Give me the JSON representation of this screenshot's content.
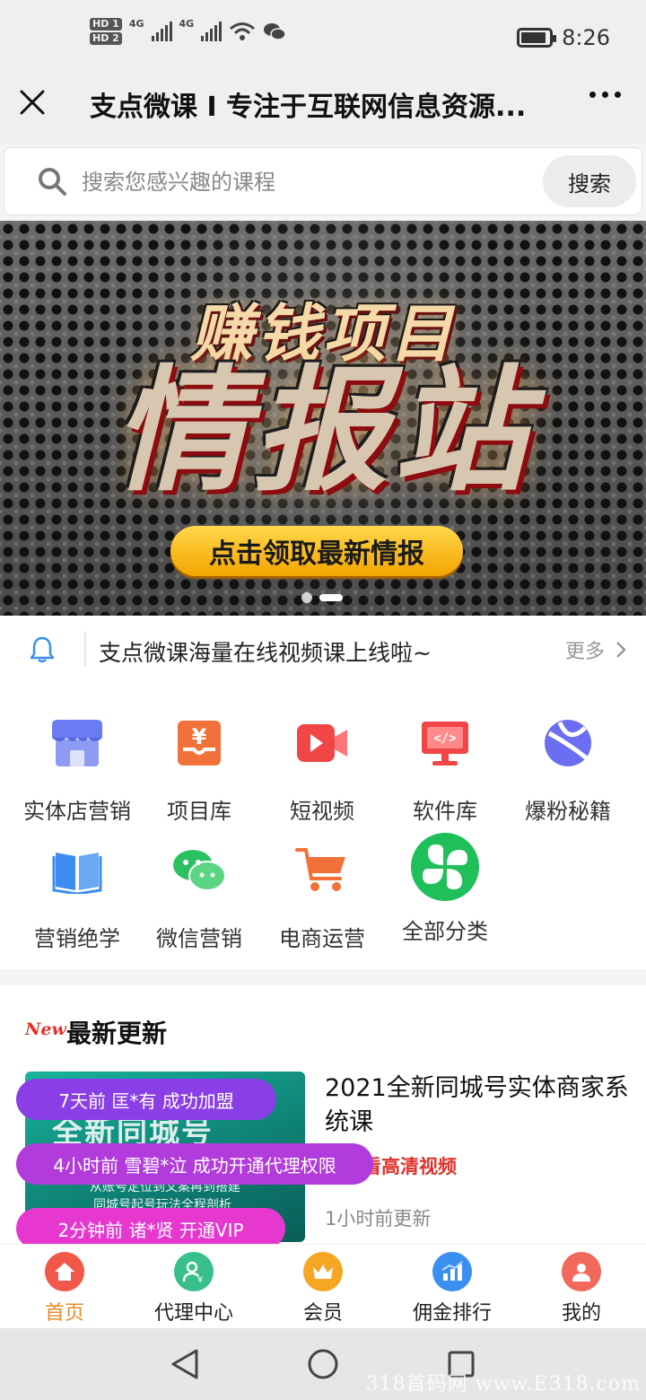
{
  "status_bar": {
    "hd1": "HD 1",
    "hd2": "HD 2",
    "net1": "4G",
    "net2": "4G",
    "time": "8:26",
    "battery_level": 0.9
  },
  "header": {
    "title": "支点微课 I 专注于互联网信息资源..."
  },
  "search": {
    "placeholder": "搜索您感兴趣的课程",
    "button_label": "搜索"
  },
  "banner": {
    "line1": "赚钱项目",
    "line2": "情报站",
    "cta": "点击领取最新情报",
    "slide_count": 2,
    "active_slide": 2
  },
  "notice": {
    "text": "支点微课海量在线视频课上线啦~",
    "more_label": "更多"
  },
  "categories": [
    {
      "label": "实体店营销",
      "icon": "storefront-icon",
      "color": "#6b7cf2"
    },
    {
      "label": "项目库",
      "icon": "yen-box-icon",
      "color": "#f2713a"
    },
    {
      "label": "短视频",
      "icon": "video-camera-icon",
      "color": "#f04646"
    },
    {
      "label": "软件库",
      "icon": "code-monitor-icon",
      "color": "#f04646"
    },
    {
      "label": "爆粉秘籍",
      "icon": "globe-icon",
      "color": "#6b6ef0"
    },
    {
      "label": "营销绝学",
      "icon": "book-icon",
      "color": "#3d8cf0"
    },
    {
      "label": "微信营销",
      "icon": "wechat-icon",
      "color": "#2cc160"
    },
    {
      "label": "电商运营",
      "icon": "shopping-cart-icon",
      "color": "#f2713a"
    },
    {
      "label": "全部分类",
      "icon": "clover-icon",
      "color": "#1fbf5a"
    }
  ],
  "latest": {
    "new_tag": "New",
    "title": "最新更新",
    "course": {
      "thumb_headline": "全新同城号",
      "thumb_line1": "从账号定位到文案再到搭建",
      "thumb_line2": "同城号起号玩法全程剖析",
      "title": "2021全新同城号实体商家系统课",
      "tag": "线观看高清视频",
      "updated": "1小时前更新"
    }
  },
  "toasts": [
    {
      "text": "7天前 匡*有 成功加盟",
      "color": "#8a3ee6"
    },
    {
      "text": "4小时前 雪碧*泣 成功开通代理权限",
      "color": "#b23bdc"
    },
    {
      "text": "2分钟前 诸*贤 开通VIP",
      "color": "#e637cf"
    }
  ],
  "bottom_nav": [
    {
      "label": "首页",
      "icon": "home-icon",
      "color": "#f2584a",
      "active": true
    },
    {
      "label": "代理中心",
      "icon": "agent-icon",
      "color": "#39c08a",
      "active": false
    },
    {
      "label": "会员",
      "icon": "crown-icon",
      "color": "#f5a623",
      "active": false
    },
    {
      "label": "佣金排行",
      "icon": "chart-icon",
      "color": "#3a8ff0",
      "active": false
    },
    {
      "label": "我的",
      "icon": "user-icon",
      "color": "#f2685a",
      "active": false
    }
  ],
  "watermark": "318首码网 www.E318.com"
}
